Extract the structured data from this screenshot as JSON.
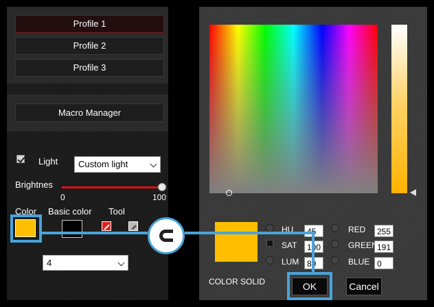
{
  "profiles": [
    "Profile 1",
    "Profile 2",
    "Profile 3"
  ],
  "macro_manager": "Macro Manager",
  "light": {
    "label": "Light",
    "checked": true,
    "mode": "Custom light"
  },
  "brightness": {
    "label": "Brightnes",
    "min": "0",
    "max": "100",
    "value": 100
  },
  "color_section": {
    "color_label": "Color",
    "basic_color_label": "Basic color",
    "tool_label": "Tool",
    "selected_color": "#ffbf00",
    "basic_color": "#000000"
  },
  "count_select": "4",
  "picker": {
    "hue_label": "HU",
    "hue_value": "45",
    "sat_label": "SAT",
    "sat_value": "100",
    "lum_label": "LUM",
    "lum_value": "89",
    "red_label": "RED",
    "red_value": "255",
    "green_label": "GREEN",
    "green_value": "191",
    "blue_label": "BLUE",
    "blue_value": "0",
    "solid_label": "COLOR SOLID"
  },
  "buttons": {
    "ok": "OK",
    "cancel": "Cancel"
  },
  "callout": {
    "icon": "c-badge-icon",
    "color": "#4aa3d9"
  }
}
